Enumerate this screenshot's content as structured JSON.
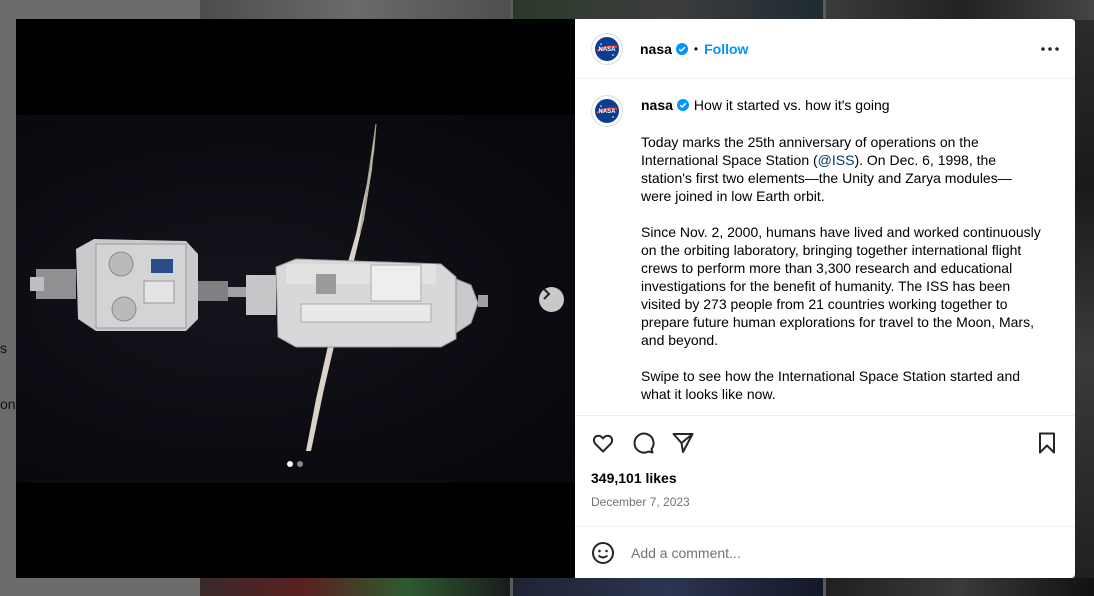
{
  "background": {
    "left_fragments": [
      "s",
      "on"
    ]
  },
  "post": {
    "author": {
      "username": "nasa",
      "verified_icon": "verified-badge-icon",
      "follow_label": "Follow",
      "separator": "•"
    },
    "caption": {
      "title": "How it started vs. how it's going",
      "paragraph_1_before_mention": "Today marks the 25th anniversary of operations on the International Space Station (",
      "mention": "@ISS",
      "paragraph_1_after_mention": "). On Dec. 6, 1998, the station's first two elements—the Unity and Zarya modules—were joined in low Earth orbit.",
      "paragraph_2": "Since Nov. 2, 2000, humans have lived and worked continuously on the orbiting laboratory, bringing together international flight crews to perform more than 3,300 research and educational investigations for the benefit of humanity. The ISS has been visited by 273 people from 21 countries working together to prepare future human explorations for travel to the Moon, Mars, and beyond.",
      "paragraph_3": "Swipe to see how the International Space Station started and what it looks like now."
    },
    "media": {
      "slide_count": 2,
      "current_slide": 1
    },
    "likes": "349,101 likes",
    "date": "December 7, 2023",
    "comment": {
      "placeholder": "Add a comment..."
    }
  },
  "colors": {
    "accent": "#0095f6",
    "mention": "#00376b",
    "muted": "#737373"
  },
  "icons": [
    "nasa-logo-icon",
    "verified-badge-icon",
    "more-options-icon",
    "heart-icon",
    "comment-icon",
    "share-icon",
    "bookmark-icon",
    "emoji-icon",
    "chevron-right-icon"
  ]
}
